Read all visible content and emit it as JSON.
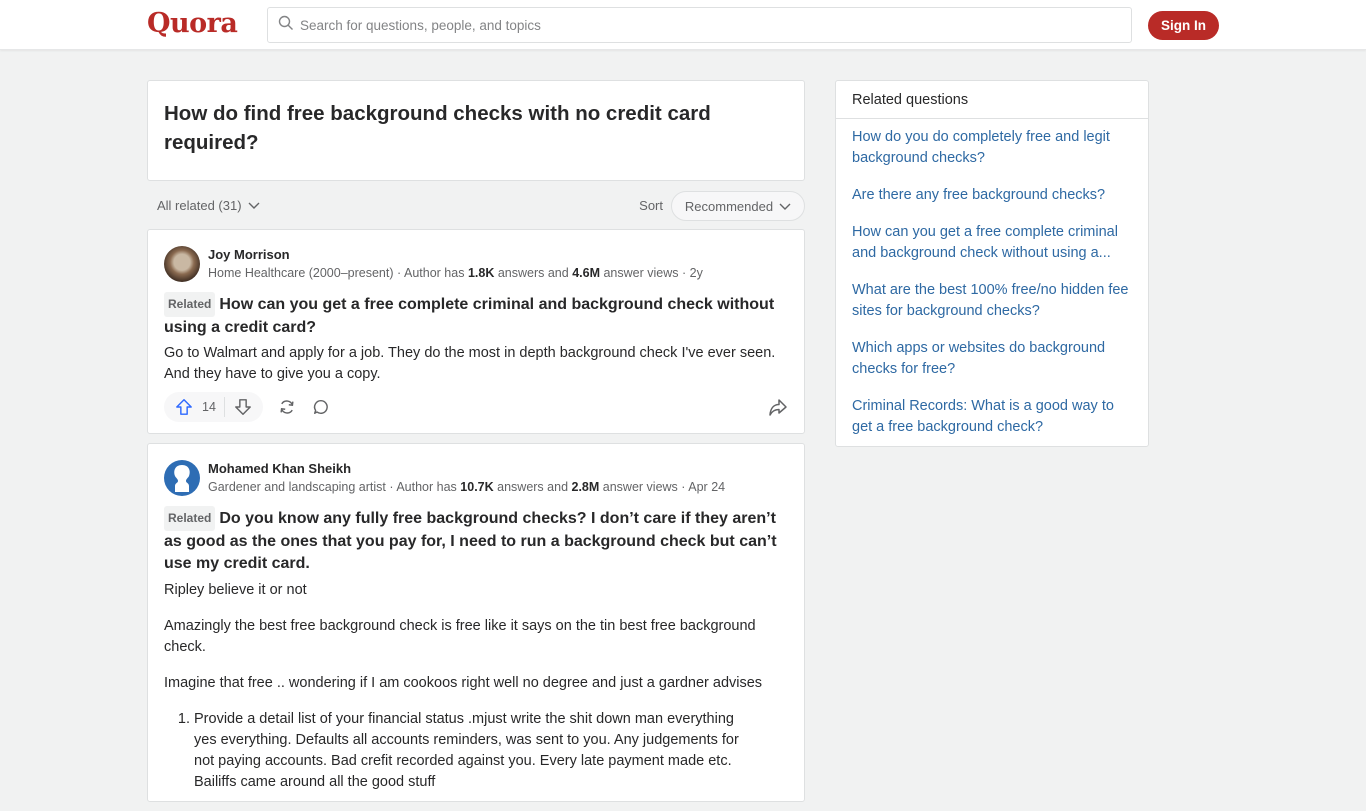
{
  "header": {
    "logo": "Quora",
    "search_placeholder": "Search for questions, people, and topics",
    "signin_label": "Sign In",
    "brand_color": "#b92b27"
  },
  "question": {
    "title": "How do find free background checks with no credit card required?"
  },
  "filter": {
    "all_related": "All related (31)",
    "sort_label": "Sort",
    "sort_value": "Recommended"
  },
  "answers": [
    {
      "author": "Joy Morrison",
      "credential": "Home Healthcare (2000–present)",
      "answers_count": "1.8K",
      "views": "4.6M",
      "time": "2y",
      "related_tag": "Related",
      "related_question": "How can you get a free complete criminal and background check without using a credit card?",
      "paragraphs": [
        "Go to Walmart and apply for a job. They do the most in depth background check I've ever seen. And they have to give you a copy."
      ],
      "upvotes": "14"
    },
    {
      "author": "Mohamed Khan Sheikh",
      "credential": "Gardener and landscaping artist",
      "answers_count": "10.7K",
      "views": "2.8M",
      "time": "Apr 24",
      "related_tag": "Related",
      "related_question": "Do you know any fully free background checks? I don’t care if they aren’t as good as the ones that you pay for, I need to run a background check but can’t use my credit card.",
      "paragraphs": [
        "Ripley believe it or not",
        "Amazingly the best free background check is free like it says on the tin best free background check.",
        "Imagine that free .. wondering if I am cookoos right well no degree and just a gardner advises"
      ],
      "list_items": [
        "Provide a detail list of your financial status .mjust write the shit down man everything yes everything. Defaults all accounts reminders, was sent to you. Any judgements for not paying accounts. Bad crefit recorded against you. Every late payment made etc. Bailiffs came around all the good stuff"
      ]
    }
  ],
  "labels": {
    "author_has": "Author has",
    "answers_and": "answers and",
    "answer_views": "answer views",
    "dot": "·"
  },
  "sidebar": {
    "title": "Related questions",
    "items": [
      "How do you do completely free and legit background checks?",
      "Are there any free background checks?",
      "How can you get a free complete criminal and background check without using a...",
      "What are the best 100% free/no hidden fee sites for background checks?",
      "Which apps or websites do background checks for free?",
      "Criminal Records: What is a good way to get a free background check?"
    ]
  }
}
